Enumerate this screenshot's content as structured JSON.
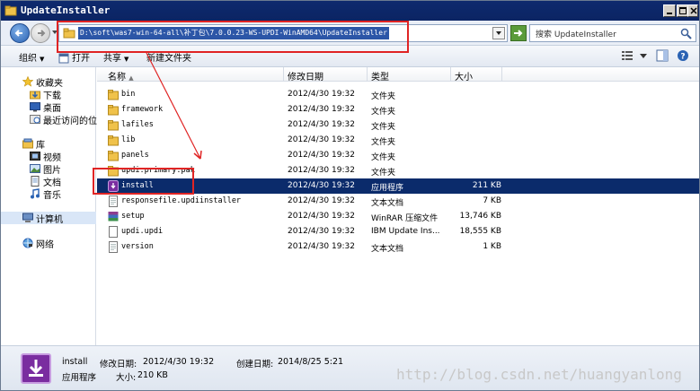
{
  "window": {
    "title": "UpdateInstaller"
  },
  "address": {
    "path": "D:\\soft\\was7-win-64-all\\补丁包\\7.0.0.23-WS-UPDI-WinAMD64\\UpdateInstaller",
    "search_placeholder": "搜索 UpdateInstaller"
  },
  "toolbar": {
    "organize": "组织",
    "open": "打开",
    "share": "共享",
    "new_folder": "新建文件夹"
  },
  "nav": {
    "favorites": "收藏夹",
    "downloads": "下载",
    "desktop": "桌面",
    "recent": "最近访问的位",
    "libraries": "库",
    "videos": "视频",
    "pictures": "图片",
    "documents": "文档",
    "music": "音乐",
    "computer": "计算机",
    "network": "网络"
  },
  "columns": {
    "name": "名称",
    "date": "修改日期",
    "type": "类型",
    "size": "大小"
  },
  "files": [
    {
      "name": "bin",
      "date": "2012/4/30 19:32",
      "type": "文件夹",
      "size": "",
      "icon": "folder-icon"
    },
    {
      "name": "framework",
      "date": "2012/4/30 19:32",
      "type": "文件夹",
      "size": "",
      "icon": "folder-icon"
    },
    {
      "name": "lafiles",
      "date": "2012/4/30 19:32",
      "type": "文件夹",
      "size": "",
      "icon": "folder-icon"
    },
    {
      "name": "lib",
      "date": "2012/4/30 19:32",
      "type": "文件夹",
      "size": "",
      "icon": "folder-icon"
    },
    {
      "name": "panels",
      "date": "2012/4/30 19:32",
      "type": "文件夹",
      "size": "",
      "icon": "folder-icon"
    },
    {
      "name": "updi.primary.pak",
      "date": "2012/4/30 19:32",
      "type": "文件夹",
      "size": "",
      "icon": "folder-icon"
    },
    {
      "name": "install",
      "date": "2012/4/30 19:32",
      "type": "应用程序",
      "size": "211 KB",
      "icon": "installer-icon"
    },
    {
      "name": "responsefile.updiinstaller",
      "date": "2012/4/30 19:32",
      "type": "文本文档",
      "size": "7 KB",
      "icon": "text-file-icon"
    },
    {
      "name": "setup",
      "date": "2012/4/30 19:32",
      "type": "WinRAR 压缩文件",
      "size": "13,746 KB",
      "icon": "archive-icon"
    },
    {
      "name": "updi.updi",
      "date": "2012/4/30 19:32",
      "type": "IBM Update Ins...",
      "size": "18,555 KB",
      "icon": "generic-file-icon"
    },
    {
      "name": "version",
      "date": "2012/4/30 19:32",
      "type": "文本文档",
      "size": "1 KB",
      "icon": "text-file-icon"
    }
  ],
  "details": {
    "name": "install",
    "modified_label": "修改日期:",
    "modified": "2012/4/30 19:32",
    "created_label": "创建日期:",
    "created": "2014/8/25 5:21",
    "type": "应用程序",
    "size_label": "大小:",
    "size": "210 KB"
  },
  "watermark": "http://blog.csdn.net/huangyanlong",
  "colors": {
    "selection": "#0b2b6b",
    "annotation": "#e02424",
    "titlebar": "#0e2a6e"
  }
}
